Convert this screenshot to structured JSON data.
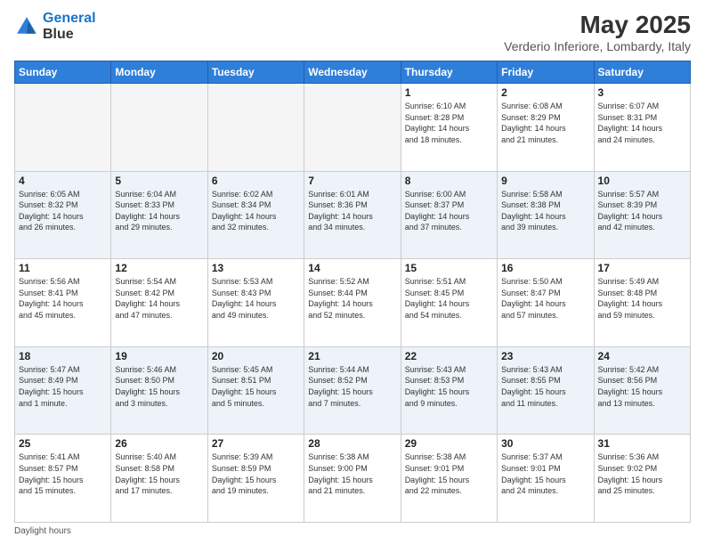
{
  "logo": {
    "line1": "General",
    "line2": "Blue"
  },
  "title": {
    "month_year": "May 2025",
    "location": "Verderio Inferiore, Lombardy, Italy"
  },
  "days_of_week": [
    "Sunday",
    "Monday",
    "Tuesday",
    "Wednesday",
    "Thursday",
    "Friday",
    "Saturday"
  ],
  "footer": {
    "note": "Daylight hours"
  },
  "weeks": [
    [
      {
        "day": "",
        "info": ""
      },
      {
        "day": "",
        "info": ""
      },
      {
        "day": "",
        "info": ""
      },
      {
        "day": "",
        "info": ""
      },
      {
        "day": "1",
        "info": "Sunrise: 6:10 AM\nSunset: 8:28 PM\nDaylight: 14 hours\nand 18 minutes."
      },
      {
        "day": "2",
        "info": "Sunrise: 6:08 AM\nSunset: 8:29 PM\nDaylight: 14 hours\nand 21 minutes."
      },
      {
        "day": "3",
        "info": "Sunrise: 6:07 AM\nSunset: 8:31 PM\nDaylight: 14 hours\nand 24 minutes."
      }
    ],
    [
      {
        "day": "4",
        "info": "Sunrise: 6:05 AM\nSunset: 8:32 PM\nDaylight: 14 hours\nand 26 minutes."
      },
      {
        "day": "5",
        "info": "Sunrise: 6:04 AM\nSunset: 8:33 PM\nDaylight: 14 hours\nand 29 minutes."
      },
      {
        "day": "6",
        "info": "Sunrise: 6:02 AM\nSunset: 8:34 PM\nDaylight: 14 hours\nand 32 minutes."
      },
      {
        "day": "7",
        "info": "Sunrise: 6:01 AM\nSunset: 8:36 PM\nDaylight: 14 hours\nand 34 minutes."
      },
      {
        "day": "8",
        "info": "Sunrise: 6:00 AM\nSunset: 8:37 PM\nDaylight: 14 hours\nand 37 minutes."
      },
      {
        "day": "9",
        "info": "Sunrise: 5:58 AM\nSunset: 8:38 PM\nDaylight: 14 hours\nand 39 minutes."
      },
      {
        "day": "10",
        "info": "Sunrise: 5:57 AM\nSunset: 8:39 PM\nDaylight: 14 hours\nand 42 minutes."
      }
    ],
    [
      {
        "day": "11",
        "info": "Sunrise: 5:56 AM\nSunset: 8:41 PM\nDaylight: 14 hours\nand 45 minutes."
      },
      {
        "day": "12",
        "info": "Sunrise: 5:54 AM\nSunset: 8:42 PM\nDaylight: 14 hours\nand 47 minutes."
      },
      {
        "day": "13",
        "info": "Sunrise: 5:53 AM\nSunset: 8:43 PM\nDaylight: 14 hours\nand 49 minutes."
      },
      {
        "day": "14",
        "info": "Sunrise: 5:52 AM\nSunset: 8:44 PM\nDaylight: 14 hours\nand 52 minutes."
      },
      {
        "day": "15",
        "info": "Sunrise: 5:51 AM\nSunset: 8:45 PM\nDaylight: 14 hours\nand 54 minutes."
      },
      {
        "day": "16",
        "info": "Sunrise: 5:50 AM\nSunset: 8:47 PM\nDaylight: 14 hours\nand 57 minutes."
      },
      {
        "day": "17",
        "info": "Sunrise: 5:49 AM\nSunset: 8:48 PM\nDaylight: 14 hours\nand 59 minutes."
      }
    ],
    [
      {
        "day": "18",
        "info": "Sunrise: 5:47 AM\nSunset: 8:49 PM\nDaylight: 15 hours\nand 1 minute."
      },
      {
        "day": "19",
        "info": "Sunrise: 5:46 AM\nSunset: 8:50 PM\nDaylight: 15 hours\nand 3 minutes."
      },
      {
        "day": "20",
        "info": "Sunrise: 5:45 AM\nSunset: 8:51 PM\nDaylight: 15 hours\nand 5 minutes."
      },
      {
        "day": "21",
        "info": "Sunrise: 5:44 AM\nSunset: 8:52 PM\nDaylight: 15 hours\nand 7 minutes."
      },
      {
        "day": "22",
        "info": "Sunrise: 5:43 AM\nSunset: 8:53 PM\nDaylight: 15 hours\nand 9 minutes."
      },
      {
        "day": "23",
        "info": "Sunrise: 5:43 AM\nSunset: 8:55 PM\nDaylight: 15 hours\nand 11 minutes."
      },
      {
        "day": "24",
        "info": "Sunrise: 5:42 AM\nSunset: 8:56 PM\nDaylight: 15 hours\nand 13 minutes."
      }
    ],
    [
      {
        "day": "25",
        "info": "Sunrise: 5:41 AM\nSunset: 8:57 PM\nDaylight: 15 hours\nand 15 minutes."
      },
      {
        "day": "26",
        "info": "Sunrise: 5:40 AM\nSunset: 8:58 PM\nDaylight: 15 hours\nand 17 minutes."
      },
      {
        "day": "27",
        "info": "Sunrise: 5:39 AM\nSunset: 8:59 PM\nDaylight: 15 hours\nand 19 minutes."
      },
      {
        "day": "28",
        "info": "Sunrise: 5:38 AM\nSunset: 9:00 PM\nDaylight: 15 hours\nand 21 minutes."
      },
      {
        "day": "29",
        "info": "Sunrise: 5:38 AM\nSunset: 9:01 PM\nDaylight: 15 hours\nand 22 minutes."
      },
      {
        "day": "30",
        "info": "Sunrise: 5:37 AM\nSunset: 9:01 PM\nDaylight: 15 hours\nand 24 minutes."
      },
      {
        "day": "31",
        "info": "Sunrise: 5:36 AM\nSunset: 9:02 PM\nDaylight: 15 hours\nand 25 minutes."
      }
    ]
  ]
}
